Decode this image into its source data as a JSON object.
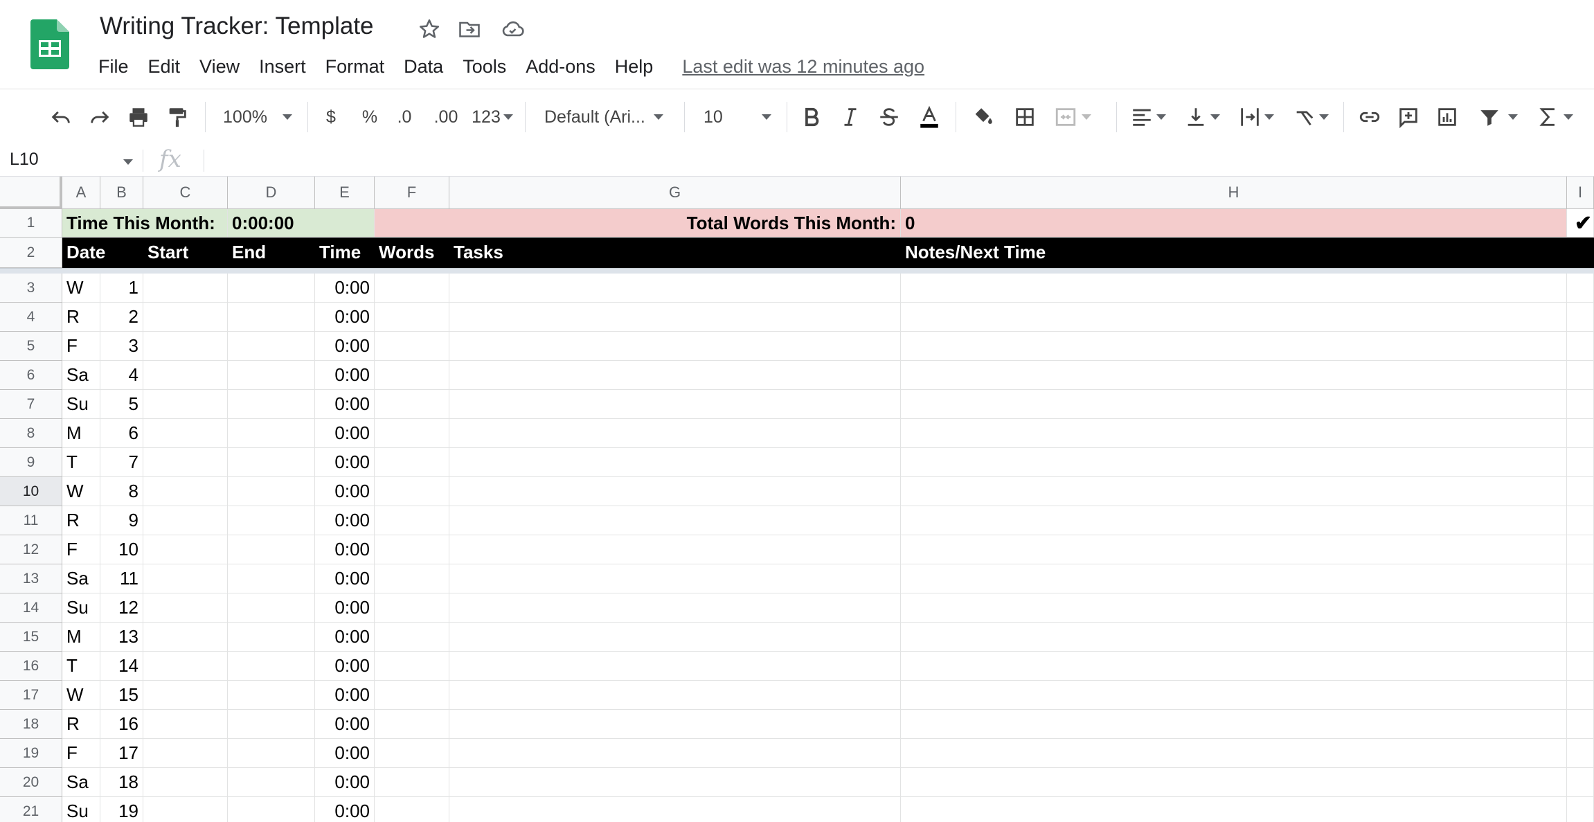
{
  "app": {
    "doc_title": "Writing Tracker: Template",
    "last_edit": "Last edit was 12 minutes ago",
    "menu": [
      "File",
      "Edit",
      "View",
      "Insert",
      "Format",
      "Data",
      "Tools",
      "Add-ons",
      "Help"
    ]
  },
  "toolbar": {
    "zoom": "100%",
    "currency": "$",
    "percent": "%",
    "decimal_decrease": ".0",
    "decimal_increase": ".00",
    "more_formats": "123",
    "font": "Default (Ari...",
    "font_size": "10"
  },
  "formula_bar": {
    "name_box": "L10",
    "fx": "fx",
    "value": ""
  },
  "grid": {
    "columns": [
      "A",
      "B",
      "C",
      "D",
      "E",
      "F",
      "G",
      "H",
      "I"
    ],
    "selected_row": 10,
    "summary": {
      "time_label": "Time This Month:",
      "time_value": "0:00:00",
      "words_label": "Total Words This Month:",
      "words_value": "0",
      "check": "✔"
    },
    "headers": [
      "Date",
      "Start",
      "End",
      "Time",
      "Words",
      "Tasks",
      "Notes/Next Time"
    ],
    "rows": [
      {
        "n": "3",
        "day": "W",
        "date": "1",
        "time": "0:00"
      },
      {
        "n": "4",
        "day": "R",
        "date": "2",
        "time": "0:00"
      },
      {
        "n": "5",
        "day": "F",
        "date": "3",
        "time": "0:00"
      },
      {
        "n": "6",
        "day": "Sa",
        "date": "4",
        "time": "0:00"
      },
      {
        "n": "7",
        "day": "Su",
        "date": "5",
        "time": "0:00"
      },
      {
        "n": "8",
        "day": "M",
        "date": "6",
        "time": "0:00"
      },
      {
        "n": "9",
        "day": "T",
        "date": "7",
        "time": "0:00"
      },
      {
        "n": "10",
        "day": "W",
        "date": "8",
        "time": "0:00"
      },
      {
        "n": "11",
        "day": "R",
        "date": "9",
        "time": "0:00"
      },
      {
        "n": "12",
        "day": "F",
        "date": "10",
        "time": "0:00"
      },
      {
        "n": "13",
        "day": "Sa",
        "date": "11",
        "time": "0:00"
      },
      {
        "n": "14",
        "day": "Su",
        "date": "12",
        "time": "0:00"
      },
      {
        "n": "15",
        "day": "M",
        "date": "13",
        "time": "0:00"
      },
      {
        "n": "16",
        "day": "T",
        "date": "14",
        "time": "0:00"
      },
      {
        "n": "17",
        "day": "W",
        "date": "15",
        "time": "0:00"
      },
      {
        "n": "18",
        "day": "R",
        "date": "16",
        "time": "0:00"
      },
      {
        "n": "19",
        "day": "F",
        "date": "17",
        "time": "0:00"
      },
      {
        "n": "20",
        "day": "Sa",
        "date": "18",
        "time": "0:00"
      },
      {
        "n": "21",
        "day": "Su",
        "date": "19",
        "time": "0:00"
      }
    ]
  },
  "colors": {
    "summary_green": "#d9ead3",
    "summary_pink": "#f4cccc",
    "header_black": "#000000",
    "sheets_green": "#0f9d58"
  }
}
